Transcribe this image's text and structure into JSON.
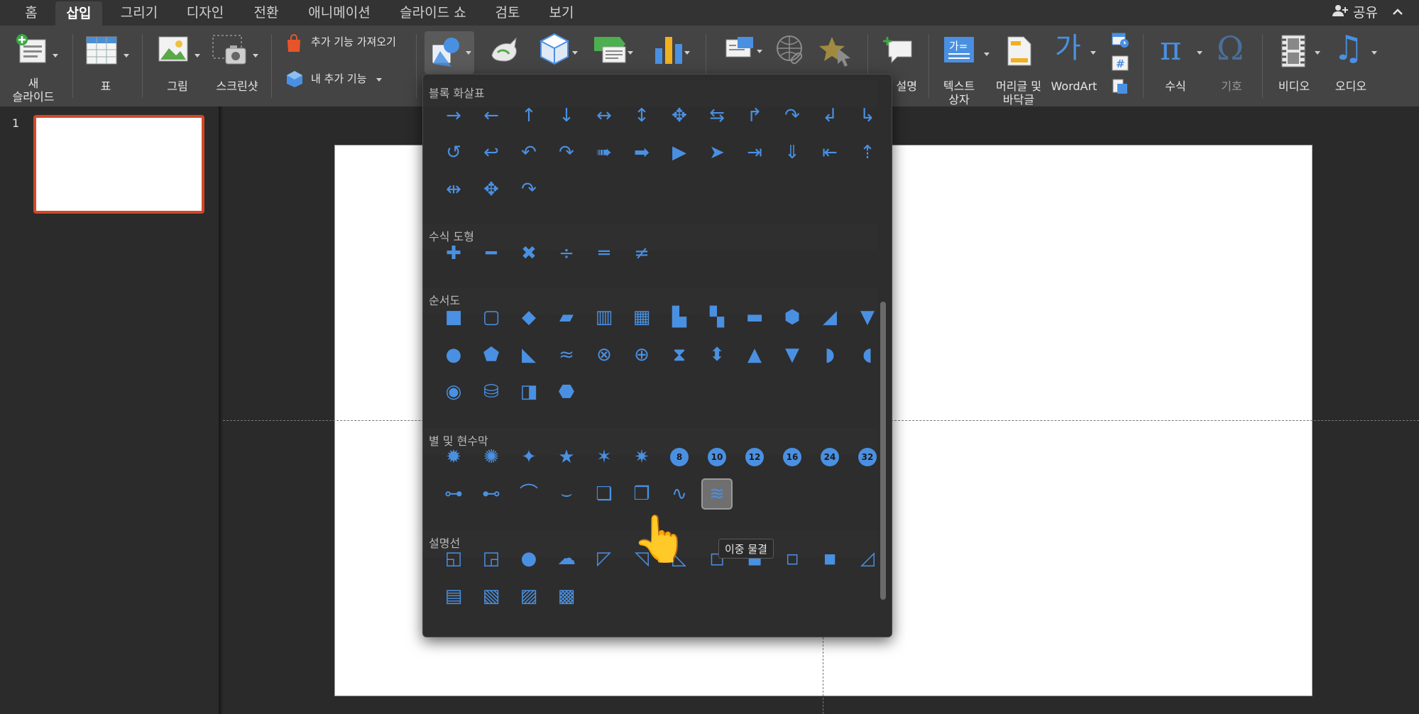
{
  "tabs": [
    {
      "label": "홈",
      "active": false
    },
    {
      "label": "삽입",
      "active": true
    },
    {
      "label": "그리기",
      "active": false
    },
    {
      "label": "디자인",
      "active": false
    },
    {
      "label": "전환",
      "active": false
    },
    {
      "label": "애니메이션",
      "active": false
    },
    {
      "label": "슬라이드 쇼",
      "active": false
    },
    {
      "label": "검토",
      "active": false
    },
    {
      "label": "보기",
      "active": false
    }
  ],
  "share_label": "공유",
  "ribbon": {
    "new_slide": "새\n슬라이드",
    "table": "표",
    "picture": "그림",
    "screenshot": "스크린샷",
    "get_addins": "추가 기능 가져오기",
    "my_addins": "내 추가 기능",
    "comment_label": "설명",
    "textbox": "텍스트\n상자",
    "header_footer": "머리글 및\n바닥글",
    "wordart": "WordArt",
    "equation": "수식",
    "symbol": "기호",
    "video": "비디오",
    "audio": "오디오"
  },
  "slide_panel": {
    "slide_number": "1"
  },
  "shapes_popup": {
    "sections": [
      {
        "title": "블록 화살표"
      },
      {
        "title": "수식 도형"
      },
      {
        "title": "순서도"
      },
      {
        "title": "별 및 현수막"
      },
      {
        "title": "설명선"
      }
    ],
    "badge_numbers": [
      "8",
      "10",
      "12",
      "16",
      "24",
      "32"
    ],
    "selected_shape_tooltip": "이중 물결"
  },
  "colors": {
    "accent_blue": "#4a90e2",
    "selection_orange": "#d04a26",
    "ribbon_bg": "#444444",
    "tabbar_bg": "#333333"
  }
}
